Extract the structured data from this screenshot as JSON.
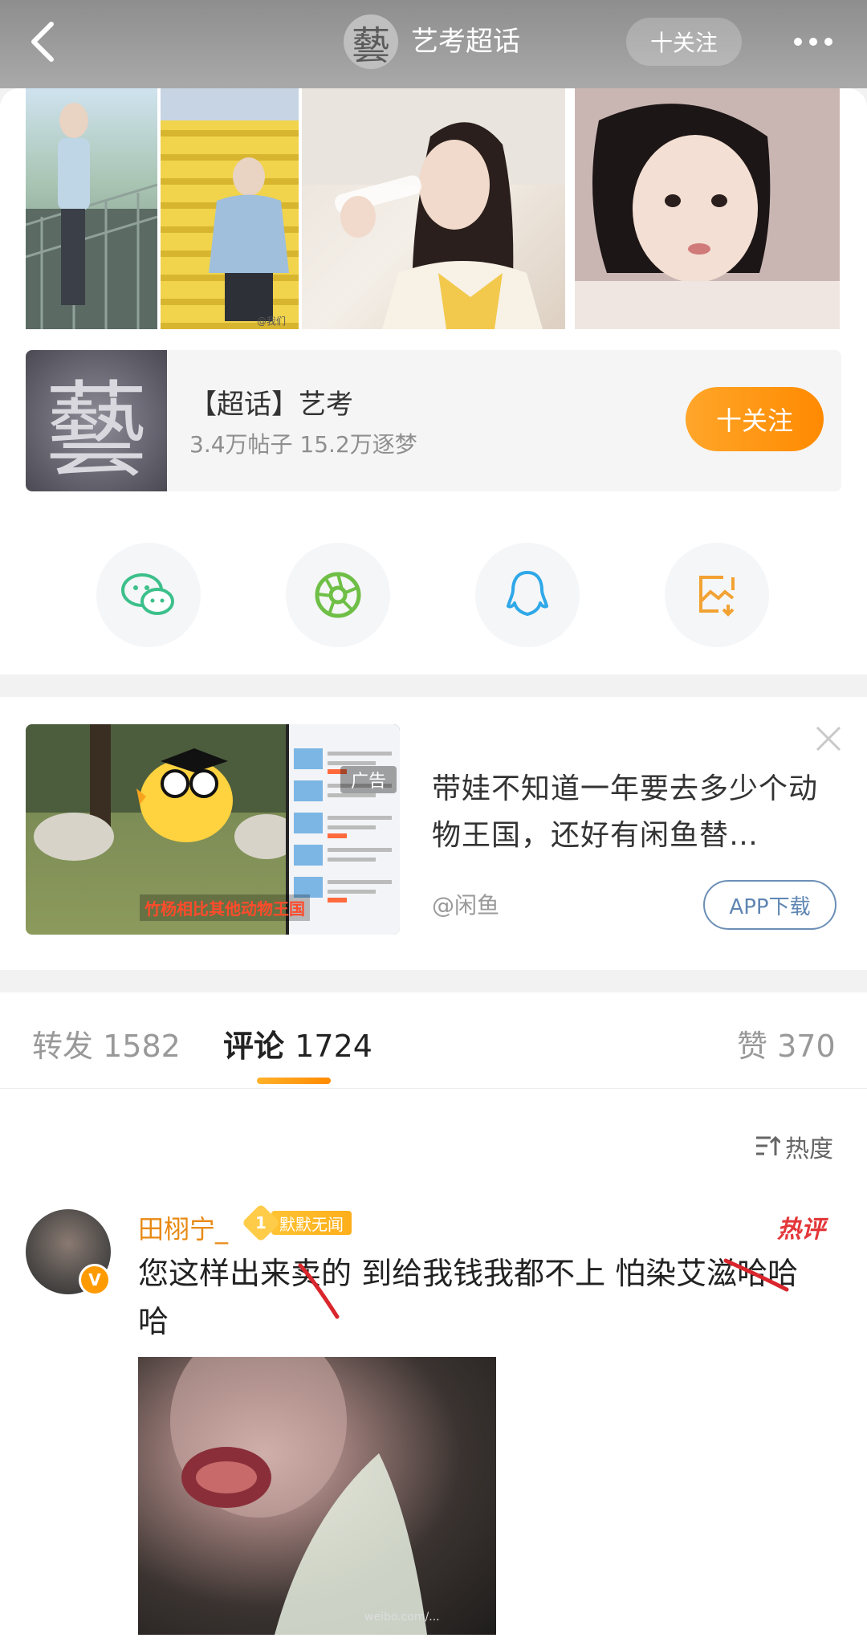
{
  "header": {
    "logo_char": "藝",
    "title": "艺考超话",
    "follow_label": "十关注"
  },
  "topic": {
    "logo_char": "藝",
    "name": "【超话】艺考",
    "stats": "3.4万帖子 15.2万逐梦",
    "follow_label": "十关注"
  },
  "photo_watermark": "@我们",
  "ad": {
    "tag": "广告",
    "caption": "竹杨相比其他动物王国",
    "text": "带娃不知道一年要去多少个动物王国，还好有闲鱼替…",
    "source": "@闲鱼",
    "download_label": "APP下载"
  },
  "tabs": [
    {
      "label": "转发",
      "count": "1582"
    },
    {
      "label": "评论",
      "count": "1724"
    },
    {
      "label": "赞",
      "count": "370"
    }
  ],
  "sort_label": "热度",
  "comment": {
    "user": "田栩宁_",
    "level": "1",
    "badge": "默默无闻",
    "hot_tag": "热评",
    "text": "您这样出来卖的 到给我钱我都不上 怕染艾滋哈哈哈",
    "image_watermark": "weibo.com/..."
  },
  "colors": {
    "accent": "#ff8a00",
    "username": "#e88a14",
    "hot": "#e3373a",
    "link": "#5f86b3"
  }
}
